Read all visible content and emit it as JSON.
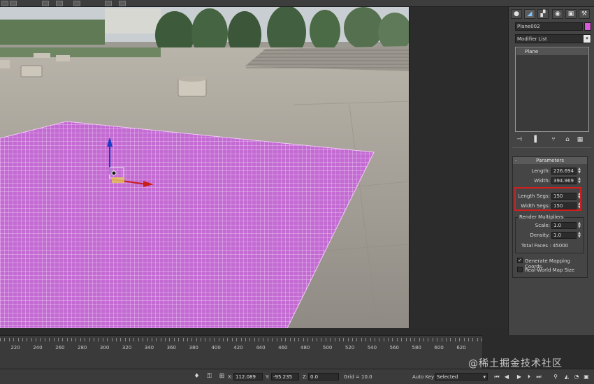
{
  "command_panel": {
    "tabs": [
      {
        "icon": "sphere-create-icon",
        "glyph": "●"
      },
      {
        "icon": "modify-icon",
        "glyph": "◢"
      },
      {
        "icon": "hierarchy-icon",
        "glyph": "▞"
      },
      {
        "icon": "motion-icon",
        "glyph": "◉"
      },
      {
        "icon": "display-icon",
        "glyph": "▣"
      },
      {
        "icon": "utilities-icon",
        "glyph": "⚒"
      }
    ],
    "object_name": "Plane002",
    "object_color": "#d85ad8",
    "modifier_list_label": "Modifier List",
    "stack_items": [
      "Plane"
    ]
  },
  "parameters": {
    "title": "Parameters",
    "collapse_glyph": "-",
    "length_label": "Length:",
    "length_value": "226.694",
    "width_label": "Width:",
    "width_value": "394.969",
    "length_segs_label": "Length Segs:",
    "length_segs_value": "150",
    "width_segs_label": "Width Segs:",
    "width_segs_value": "150",
    "render_multipliers_label": "Render Multipliers",
    "scale_label": "Scale:",
    "scale_value": "1.0",
    "density_label": "Density:",
    "density_value": "1.0",
    "total_faces_label": "Total Faces : 45000",
    "generate_mapping_label": "Generate Mapping Coords.",
    "generate_mapping_checked": true,
    "real_world_label": "Real-World Map Size",
    "real_world_checked": false
  },
  "timeline": {
    "ticks": [
      "220",
      "240",
      "260",
      "280",
      "300",
      "320",
      "340",
      "360",
      "380",
      "400",
      "420",
      "440",
      "460",
      "480",
      "500",
      "520",
      "540",
      "560",
      "580",
      "600",
      "620"
    ]
  },
  "statusbar": {
    "x_label": "X:",
    "x_value": "112.089",
    "y_label": "Y:",
    "y_value": "-95.235",
    "z_label": "Z:",
    "z_value": "0.0",
    "grid_label": "Grid = 10.0",
    "auto_key_label": "Auto Key",
    "selected_option": "Selected"
  },
  "watermark": "@稀土掘金技术社区",
  "accent_colors": {
    "highlight_box": "#d21e1e",
    "plane_mesh": "#c46bd2"
  }
}
